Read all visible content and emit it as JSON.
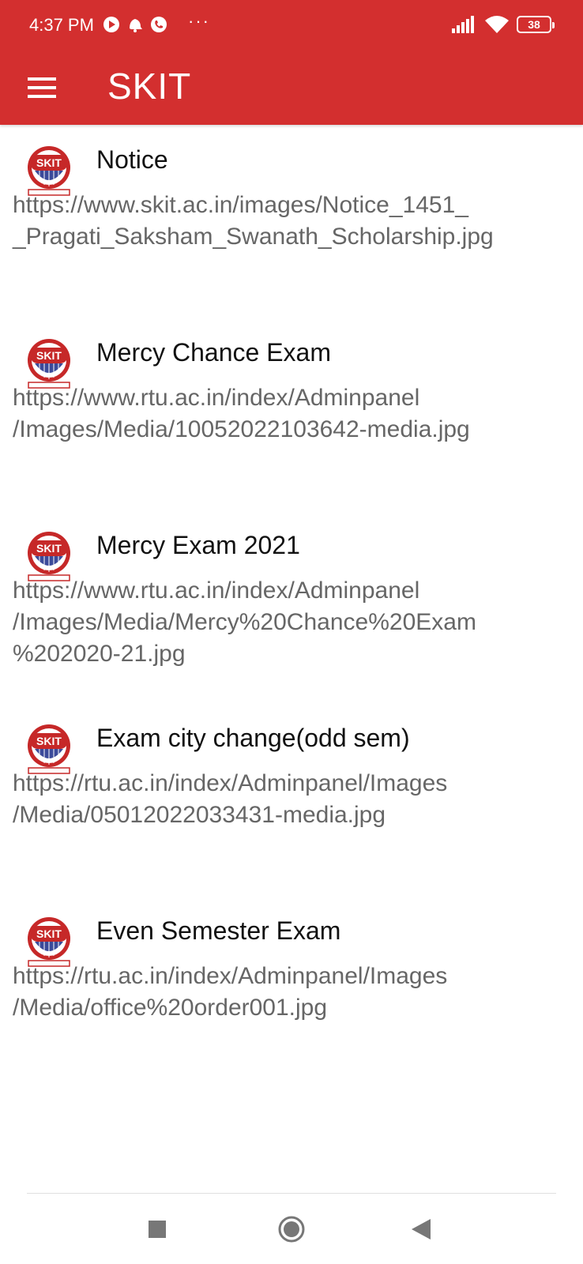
{
  "status_bar": {
    "time": "4:37 PM",
    "more": "···",
    "battery": "38",
    "icons": [
      "play-icon",
      "notification-icon",
      "phone-icon",
      "signal-icon",
      "wifi-icon",
      "battery-icon"
    ]
  },
  "app_bar": {
    "title": "SKIT",
    "menu_icon": "hamburger-menu-icon"
  },
  "colors": {
    "primary": "#d32f2f",
    "title_text": "#111111",
    "url_text": "#666666"
  },
  "list": {
    "items": [
      {
        "title": "Notice",
        "url": "https://www.skit.ac.in/images/Notice_1451_\n_Pragati_Saksham_Swanath_Scholarship.jpg",
        "logo_text": "SKIT"
      },
      {
        "title": "Mercy Chance Exam",
        "url": "https://www.rtu.ac.in/index/Adminpanel\n/Images/Media/10052022103642-media.jpg",
        "logo_text": "SKIT"
      },
      {
        "title": "Mercy Exam 2021",
        "url": "https://www.rtu.ac.in/index/Adminpanel\n/Images/Media/Mercy%20Chance%20Exam\n%202020-21.jpg",
        "logo_text": "SKIT"
      },
      {
        "title": "Exam city change(odd sem)",
        "url": "https://rtu.ac.in/index/Adminpanel/Images\n/Media/05012022033431-media.jpg",
        "logo_text": "SKIT"
      },
      {
        "title": "Even Semester Exam",
        "url": "https://rtu.ac.in/index/Adminpanel/Images\n/Media/office%20order001.jpg",
        "logo_text": "SKIT"
      }
    ]
  },
  "nav_bar": {
    "recents": "recents-square-icon",
    "home": "home-circle-icon",
    "back": "back-triangle-icon"
  }
}
